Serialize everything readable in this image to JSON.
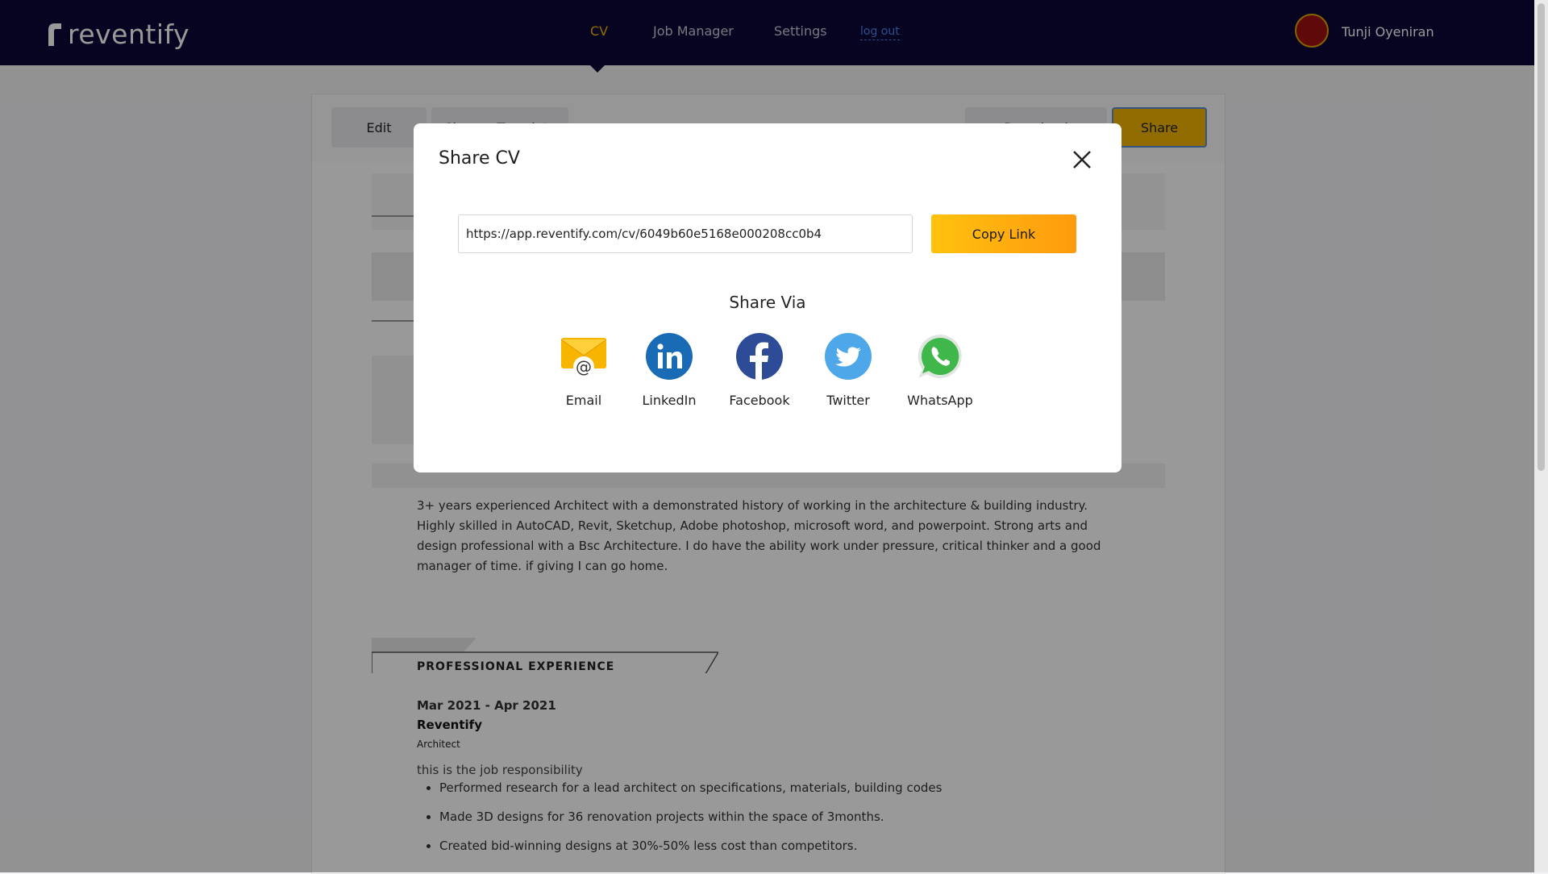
{
  "app": {
    "logo_text": "reventify"
  },
  "nav": {
    "items": [
      {
        "label": "CV"
      },
      {
        "label": "Job Manager"
      },
      {
        "label": "Settings"
      }
    ],
    "logout_label": "log out",
    "user_name": "Tunji Oyeniran"
  },
  "toolbar": {
    "edit_label": "Edit",
    "change_template_label": "Change Template",
    "download_label": "Download",
    "share_label": "Share"
  },
  "cv": {
    "about": "3+ years experienced Architect with a demonstrated history of working in the architecture & building industry. Highly skilled in AutoCAD, Revit, Sketchup, Adobe photoshop, microsoft word, and powerpoint. Strong arts and design professional with a Bsc  Architecture. I do have the ability work under pressure, critical thinker and a good manager of time. if giving I can go home.",
    "experience_heading": "PROFESSIONAL EXPERIENCE",
    "experience": {
      "date": "Mar 2021 - Apr 2021",
      "company": "Reventify",
      "role": "Architect",
      "responsibility": "this is the job responsibility",
      "bullets": [
        "Performed research for a lead architect on specifications, materials, building codes",
        "Made 3D designs for 36 renovation projects within the space of 3months.",
        "Created bid-winning designs at 30%-50% less cost than competitors."
      ]
    }
  },
  "modal": {
    "title": "Share CV",
    "url": "https://app.reventify.com/cv/6049b60e5168e000208cc0b4",
    "copy_label": "Copy Link",
    "share_via": "Share Via",
    "options": [
      {
        "label": "Email",
        "icon": "email-icon"
      },
      {
        "label": "LinkedIn",
        "icon": "linkedin-icon"
      },
      {
        "label": "Facebook",
        "icon": "facebook-icon"
      },
      {
        "label": "Twitter",
        "icon": "twitter-icon"
      },
      {
        "label": "WhatsApp",
        "icon": "whatsapp-icon"
      }
    ]
  },
  "colors": {
    "nav_bg": "#0b0736",
    "accent": "#f7b500",
    "link": "#4a86e8",
    "linkedin": "#1a6bb5",
    "facebook": "#2e4b98",
    "twitter": "#4da7e8",
    "whatsapp": "#3fb74a"
  }
}
